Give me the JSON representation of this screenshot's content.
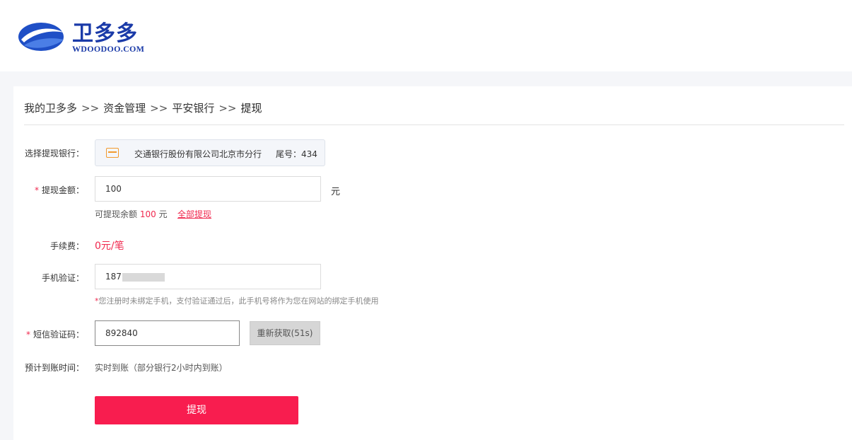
{
  "brand": {
    "name": "卫多多",
    "domain": "WDOODOO.COM"
  },
  "breadcrumb": {
    "items": [
      "我的卫多多",
      "资金管理",
      "平安银行"
    ],
    "separator": ">>",
    "current": "提现"
  },
  "form": {
    "bank": {
      "label": "选择提现银行：",
      "bank_name": "交通银行股份有限公司北京市分行",
      "tail": "尾号：434"
    },
    "amount": {
      "label": "提现金额：",
      "value": "100",
      "unit": "元",
      "balance_prefix": "可提现余额",
      "balance_value": "100",
      "balance_unit": "元",
      "withdraw_all": "全部提现"
    },
    "fee": {
      "label": "手续费：",
      "value": "0元/笔"
    },
    "phone": {
      "label": "手机验证：",
      "value": "187",
      "note_star": "*",
      "note": "您注册时未绑定手机，支付验证通过后，此手机号将作为您在网站的绑定手机使用"
    },
    "sms": {
      "label": "短信验证码：",
      "value": "892840",
      "resend": "重新获取(51s)"
    },
    "eta": {
      "label": "预计到账时间：",
      "value": "实时到账（部分银行2小时内到账）"
    },
    "submit": "提现"
  },
  "colors": {
    "accent": "#f81d4f",
    "brand": "#1a3aa8",
    "card_icon": "#f29a2e"
  }
}
